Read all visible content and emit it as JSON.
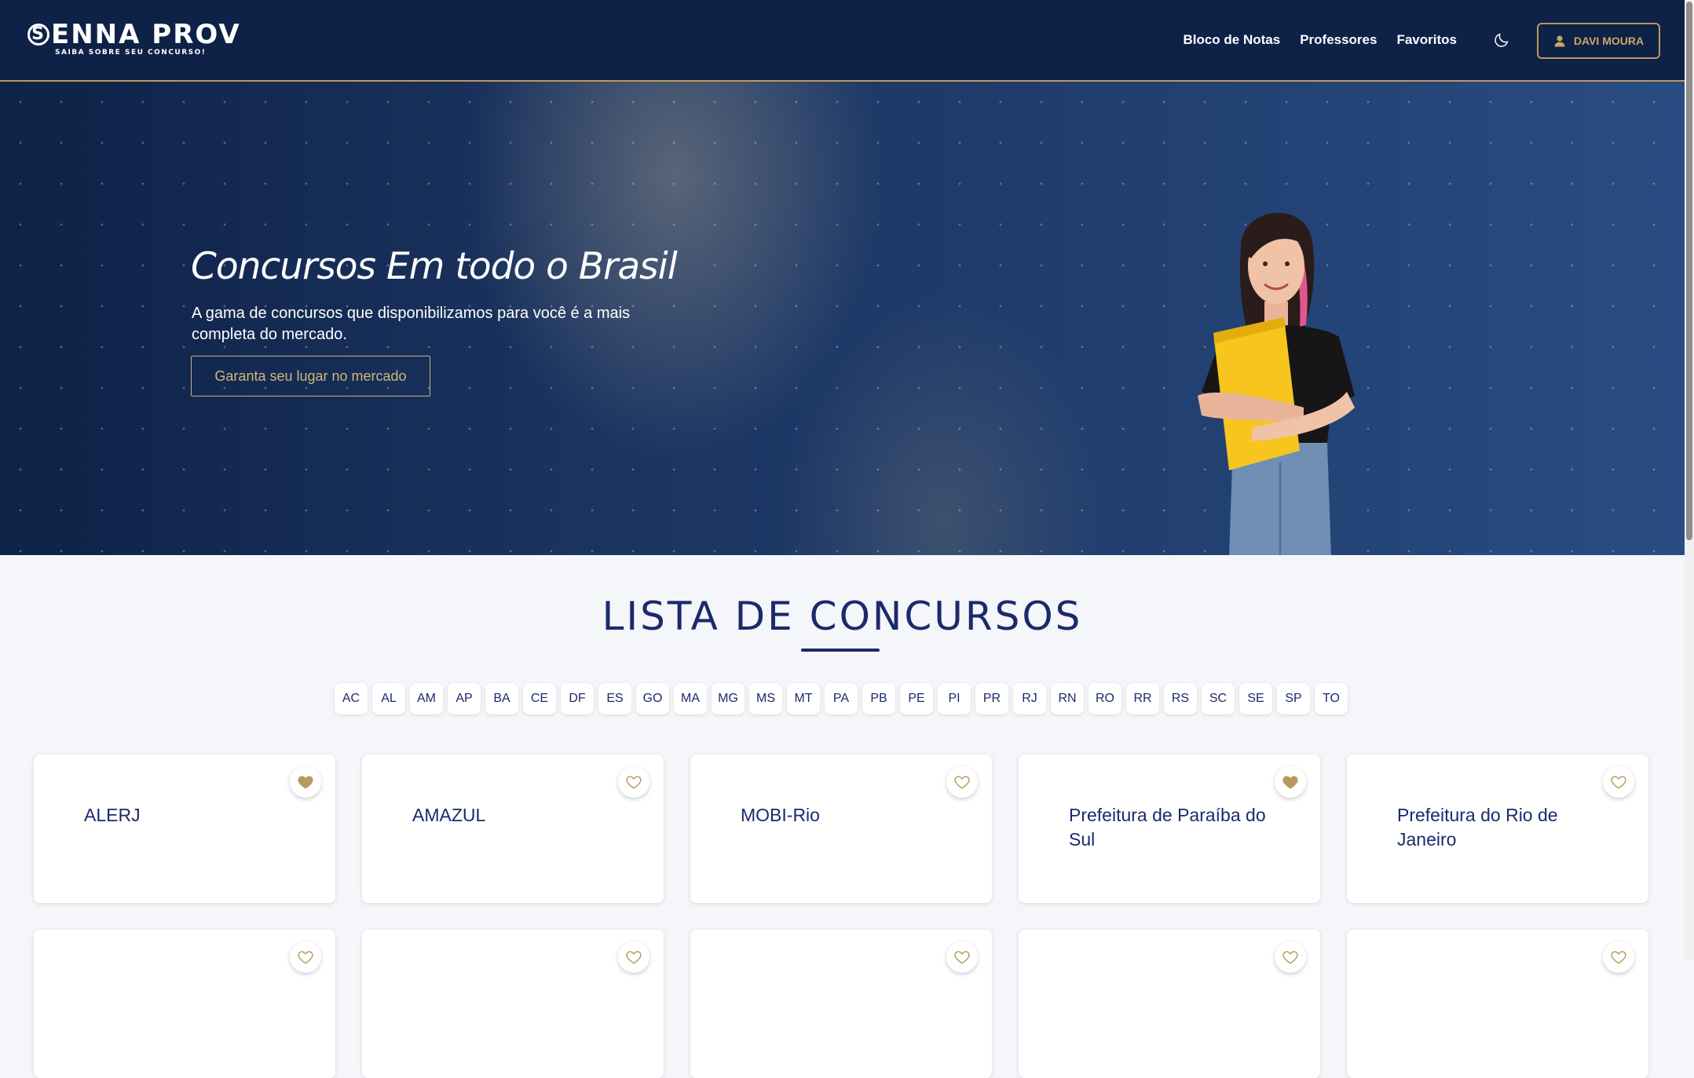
{
  "header": {
    "logo_main": "ENNA PROV",
    "logo_s": "S",
    "logo_sub": "SAIBA SOBRE SEU CONCURSO!",
    "nav": [
      "Bloco de Notas",
      "Professores",
      "Favoritos"
    ],
    "theme_icon": "moon-icon",
    "user_name": "DAVI MOURA",
    "user_icon": "user-icon"
  },
  "hero": {
    "title": "Concursos Em todo o Brasil",
    "text": "A gama de concursos que disponibilizamos para você é a mais completa do mercado.",
    "button": "Garanta seu lugar no mercado"
  },
  "section": {
    "title": "LISTA DE CONCURSOS",
    "states": [
      "AC",
      "AL",
      "AM",
      "AP",
      "BA",
      "CE",
      "DF",
      "ES",
      "GO",
      "MA",
      "MG",
      "MS",
      "MT",
      "PA",
      "PB",
      "PE",
      "PI",
      "PR",
      "RJ",
      "RN",
      "RO",
      "RR",
      "RS",
      "SC",
      "SE",
      "SP",
      "TO"
    ]
  },
  "cards": [
    {
      "title": "ALERJ",
      "favorite": true
    },
    {
      "title": "AMAZUL",
      "favorite": false
    },
    {
      "title": "MOBI-Rio",
      "favorite": false
    },
    {
      "title": "Prefeitura de Paraíba do Sul",
      "favorite": true
    },
    {
      "title": "Prefeitura do Rio de Janeiro",
      "favorite": false
    },
    {
      "title": "",
      "favorite": false
    },
    {
      "title": "",
      "favorite": false
    },
    {
      "title": "",
      "favorite": false
    },
    {
      "title": "",
      "favorite": false
    },
    {
      "title": "",
      "favorite": false
    }
  ],
  "colors": {
    "navy": "#0e2146",
    "gold": "#b99a5e",
    "heading": "#1b2a6b"
  }
}
